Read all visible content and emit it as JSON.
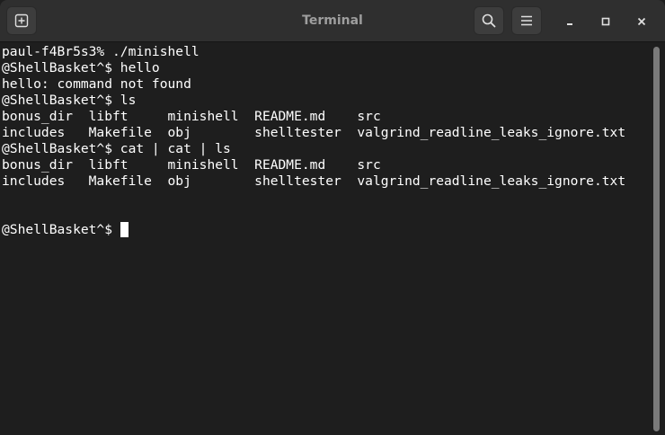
{
  "window": {
    "title": "Terminal"
  },
  "header": {
    "new_tab_icon": "new-tab-icon",
    "search_icon": "search-icon",
    "menu_icon": "hamburger-menu-icon",
    "minimize_icon": "minimize-icon",
    "maximize_icon": "maximize-icon",
    "close_icon": "close-icon"
  },
  "terminal": {
    "lines": [
      "paul-f4Br5s3% ./minishell",
      "@ShellBasket^$ hello",
      "hello: command not found",
      "@ShellBasket^$ ls",
      "bonus_dir  libft     minishell  README.md    src",
      "includes   Makefile  obj        shelltester  valgrind_readline_leaks_ignore.txt",
      "@ShellBasket^$ cat | cat | ls",
      "bonus_dir  libft     minishell  README.md    src",
      "includes   Makefile  obj        shelltester  valgrind_readline_leaks_ignore.txt",
      "",
      "",
      "@ShellBasket^$ "
    ]
  },
  "colors": {
    "background": "#1e1e1e",
    "titlebar": "#2f2f2f",
    "text": "#ffffff"
  }
}
